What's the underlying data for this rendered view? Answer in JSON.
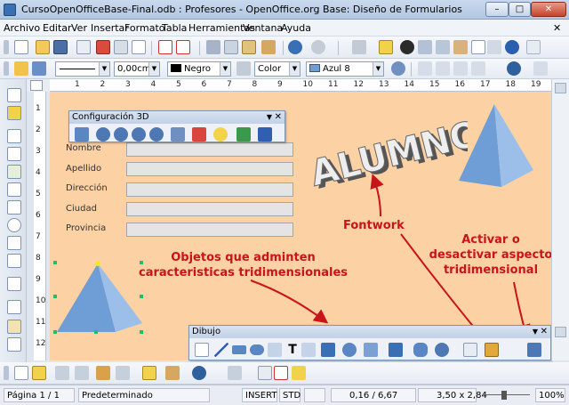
{
  "window": {
    "title": "CursoOpenOfficeBase-Final.odb : Profesores - OpenOffice.org Base: Diseño de Formularios",
    "close": "✕",
    "maximize": "□",
    "minimize": "–"
  },
  "menubar": {
    "items": [
      "Archivo",
      "Editar",
      "Ver",
      "Insertar",
      "Formato",
      "Tabla",
      "Herramientas",
      "Ventana",
      "Ayuda"
    ],
    "close": "✕"
  },
  "format_toolbar": {
    "line_width": "0,00cm",
    "line_color": "Negro",
    "fill_type": "Color",
    "fill_color": "Azul 8"
  },
  "rulers": {
    "h": [
      "1",
      "2",
      "3",
      "4",
      "5",
      "6",
      "7",
      "8",
      "9",
      "10",
      "11",
      "12",
      "13",
      "14",
      "15",
      "16",
      "17",
      "18",
      "19"
    ],
    "v": [
      "1",
      "2",
      "3",
      "4",
      "5",
      "6",
      "7",
      "8",
      "9",
      "10",
      "11",
      "12"
    ]
  },
  "form": {
    "labels": [
      "Nombre",
      "Apellido",
      "Dirección",
      "Ciudad",
      "Provincia"
    ]
  },
  "config3d": {
    "title": "Configuración 3D",
    "close": "✕"
  },
  "dibujo": {
    "title": "Dibujo",
    "close": "✕"
  },
  "fontwork_text": "ALUMNOS",
  "annotations": {
    "fontwork": "Fontwork",
    "objetos": [
      "Objetos que adminten",
      "caracteristicas tridimensionales"
    ],
    "activar": [
      "Activar o",
      "desactivar aspecto",
      "tridimensional"
    ]
  },
  "status": {
    "page": "Página 1 / 1",
    "style": "Predeterminado",
    "insert": "INSERT",
    "std": "STD",
    "position": "0,16 / 6,67",
    "size": "3,50 x 2,84",
    "zoom": "100%"
  },
  "colors": {
    "accent": "#c8141a",
    "doc_bg": "#fcd1a4",
    "pyramid": "#6f9ed6"
  }
}
